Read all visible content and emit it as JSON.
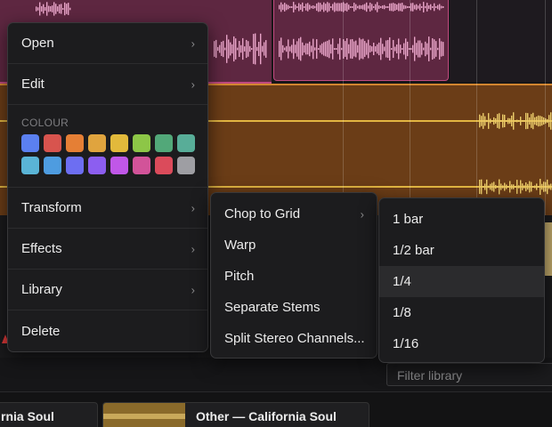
{
  "context_menu": {
    "items_top": [
      {
        "label": "Open",
        "has_submenu": true
      },
      {
        "label": "Edit",
        "has_submenu": true
      }
    ],
    "colour_label": "COLOUR",
    "colours": [
      "#5b80f0",
      "#d8544e",
      "#e57f35",
      "#e0a43e",
      "#e2b93b",
      "#8dc647",
      "#52a879",
      "#58ad98",
      "#5ab4d6",
      "#4e9ce0",
      "#6d6ef2",
      "#8c5ef0",
      "#c057e8",
      "#d25399",
      "#db4b5b",
      "#9e9ea3"
    ],
    "items_bottom": [
      {
        "label": "Transform",
        "has_submenu": true
      },
      {
        "label": "Effects",
        "has_submenu": true
      },
      {
        "label": "Library",
        "has_submenu": true
      },
      {
        "label": "Delete",
        "has_submenu": false
      }
    ],
    "chevron": "›"
  },
  "transform_menu": {
    "items": [
      {
        "label": "Chop to Grid",
        "has_submenu": true
      },
      {
        "label": "Warp"
      },
      {
        "label": "Pitch"
      },
      {
        "label": "Separate Stems"
      },
      {
        "label": "Split Stereo Channels..."
      }
    ]
  },
  "grid_menu": {
    "items": [
      "1 bar",
      "1/2 bar",
      "1/4",
      "1/8",
      "1/16"
    ],
    "highlighted": "1/4"
  },
  "library": {
    "filter_placeholder": "Filter library",
    "cards": [
      "rnia Soul",
      "Other — California Soul"
    ]
  }
}
